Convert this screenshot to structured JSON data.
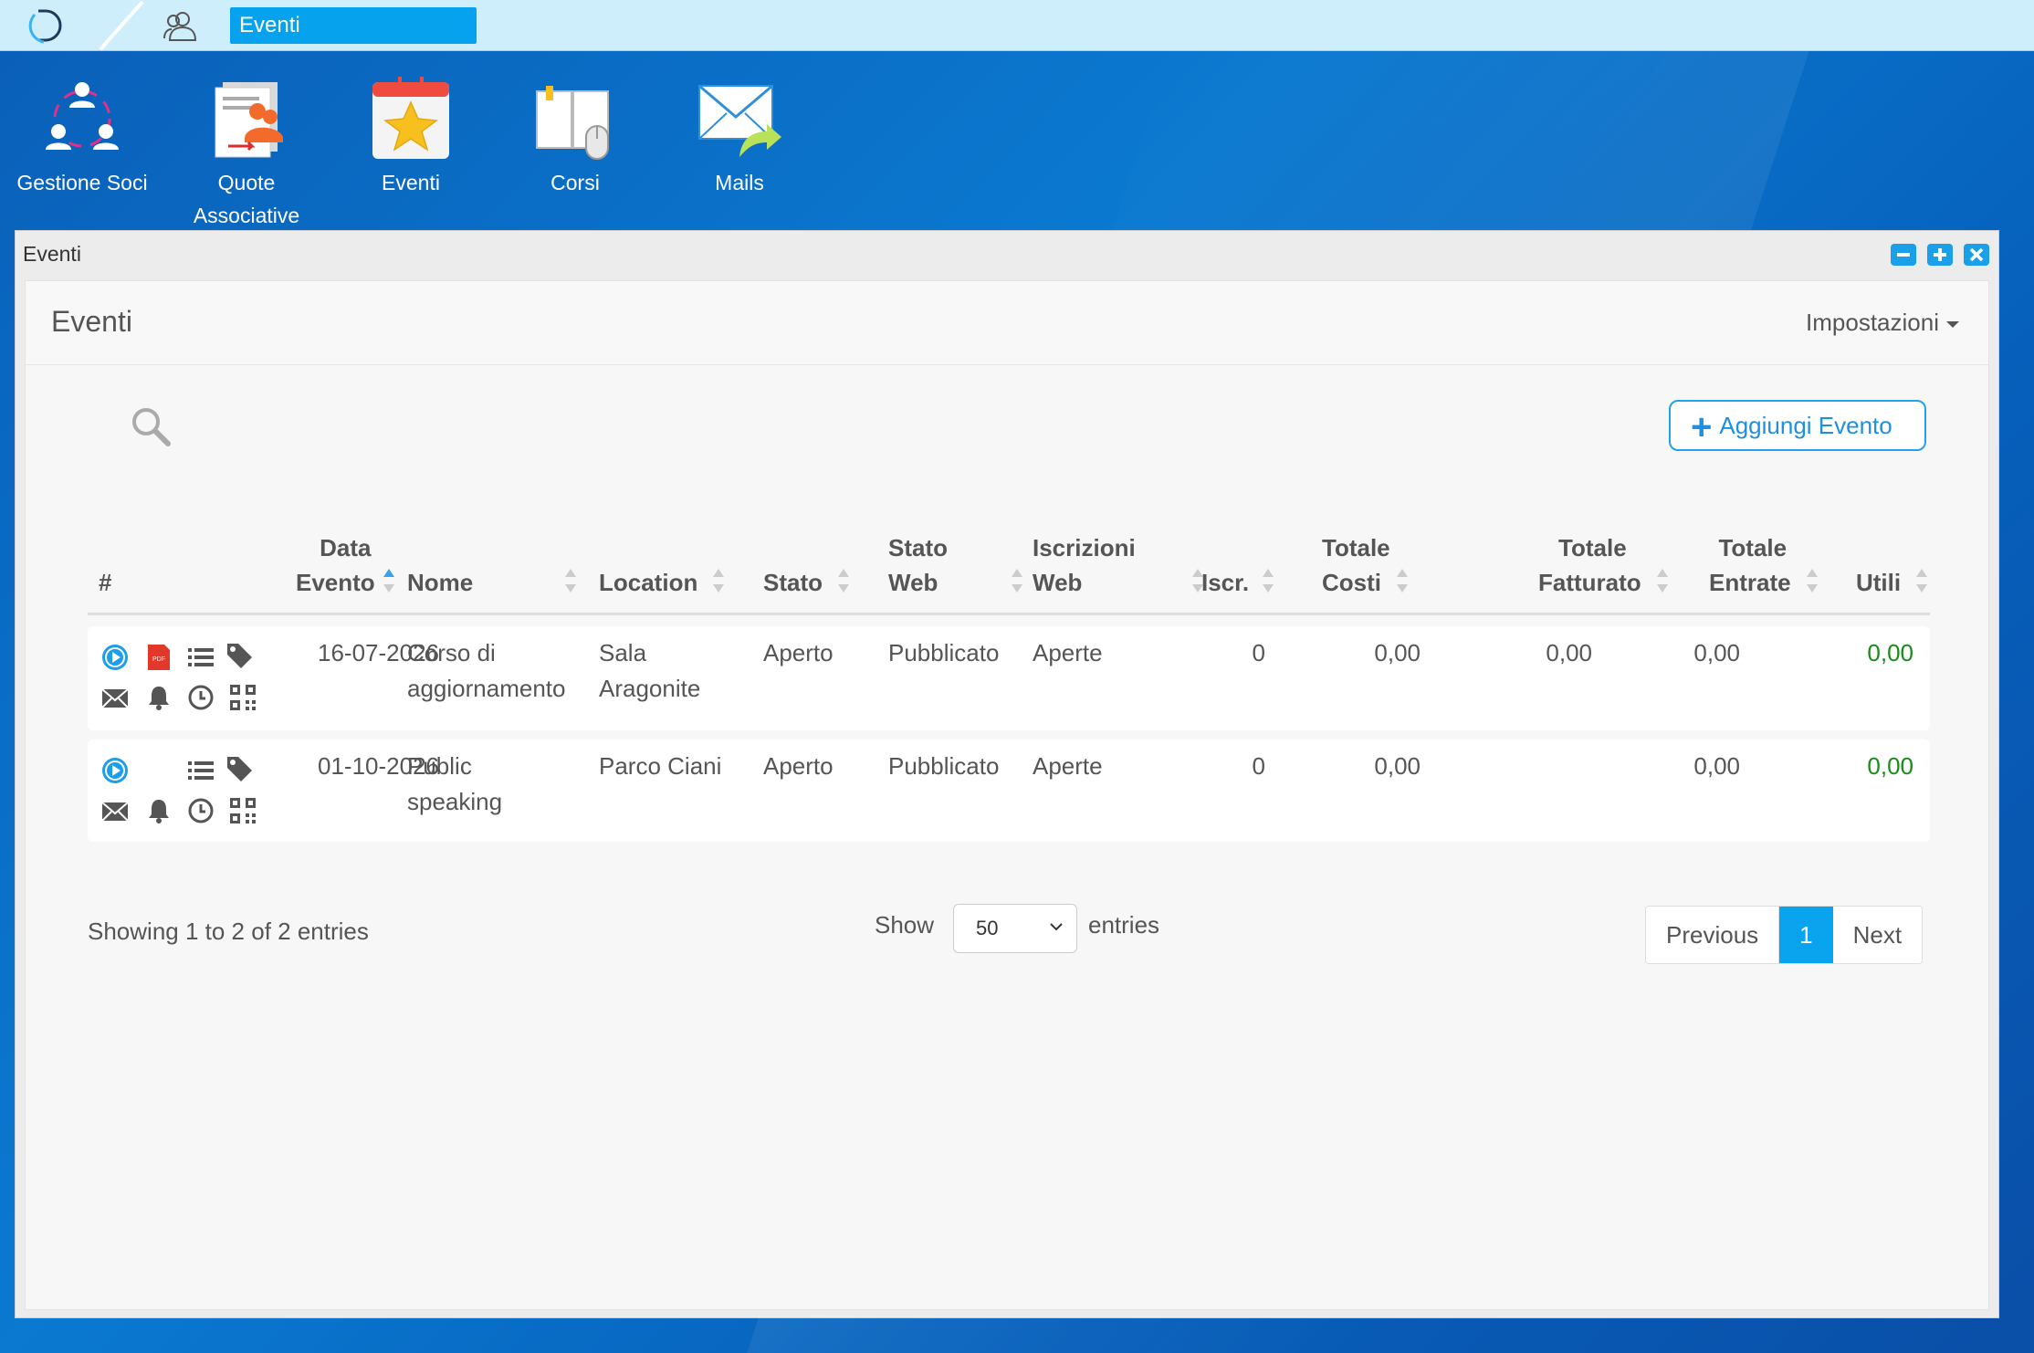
{
  "topbar": {
    "active_tab": "Eventi"
  },
  "launcher": [
    {
      "line1": "Gestione Soci",
      "line2": ""
    },
    {
      "line1": "Quote",
      "line2": "Associative"
    },
    {
      "line1": "Eventi",
      "line2": ""
    },
    {
      "line1": "Corsi",
      "line2": ""
    },
    {
      "line1": "Mails",
      "line2": ""
    }
  ],
  "window": {
    "title": "Eventi",
    "panel_title": "Eventi",
    "settings_label": "Impostazioni",
    "add_button_label": "Aggiungi Evento"
  },
  "table": {
    "headers": {
      "hash": "#",
      "data_l1": "Data",
      "data_l2": "Evento",
      "nome": "Nome",
      "location": "Location",
      "stato": "Stato",
      "stato_web_l1": "Stato",
      "stato_web_l2": "Web",
      "iscrizioni_l1": "Iscrizioni",
      "iscrizioni_l2": "Web",
      "iscr": "Iscr.",
      "costi_l1": "Totale",
      "costi_l2": "Costi",
      "fatturato_l1": "Totale",
      "fatturato_l2": "Fatturato",
      "entrate_l1": "Totale",
      "entrate_l2": "Entrate",
      "utili": "Utili"
    },
    "rows": [
      {
        "data": "16-07-2026",
        "nome_l1": "Corso di",
        "nome_l2": "aggiornamento",
        "location_l1": "Sala",
        "location_l2": "Aragonite",
        "stato": "Aperto",
        "stato_web": "Pubblicato",
        "iscrizioni_web": "Aperte",
        "iscr": "0",
        "costi": "0,00",
        "fatturato": "0,00",
        "entrate": "0,00",
        "utili": "0,00",
        "has_pdf": true
      },
      {
        "data": "01-10-2026",
        "nome_l1": "Public",
        "nome_l2": "speaking",
        "location_l1": "Parco Ciani",
        "location_l2": "",
        "stato": "Aperto",
        "stato_web": "Pubblicato",
        "iscrizioni_web": "Aperte",
        "iscr": "0",
        "costi": "0,00",
        "fatturato": "",
        "entrate": "0,00",
        "utili": "0,00",
        "has_pdf": false
      }
    ]
  },
  "footer": {
    "info": "Showing 1 to 2 of 2 entries",
    "show_label": "Show",
    "page_size": "50",
    "entries_label": "entries",
    "previous": "Previous",
    "current_page": "1",
    "next": "Next"
  },
  "colors": {
    "accent": "#0aa4ee",
    "positive": "#1a8a1a",
    "topbar": "#cdeefa"
  }
}
